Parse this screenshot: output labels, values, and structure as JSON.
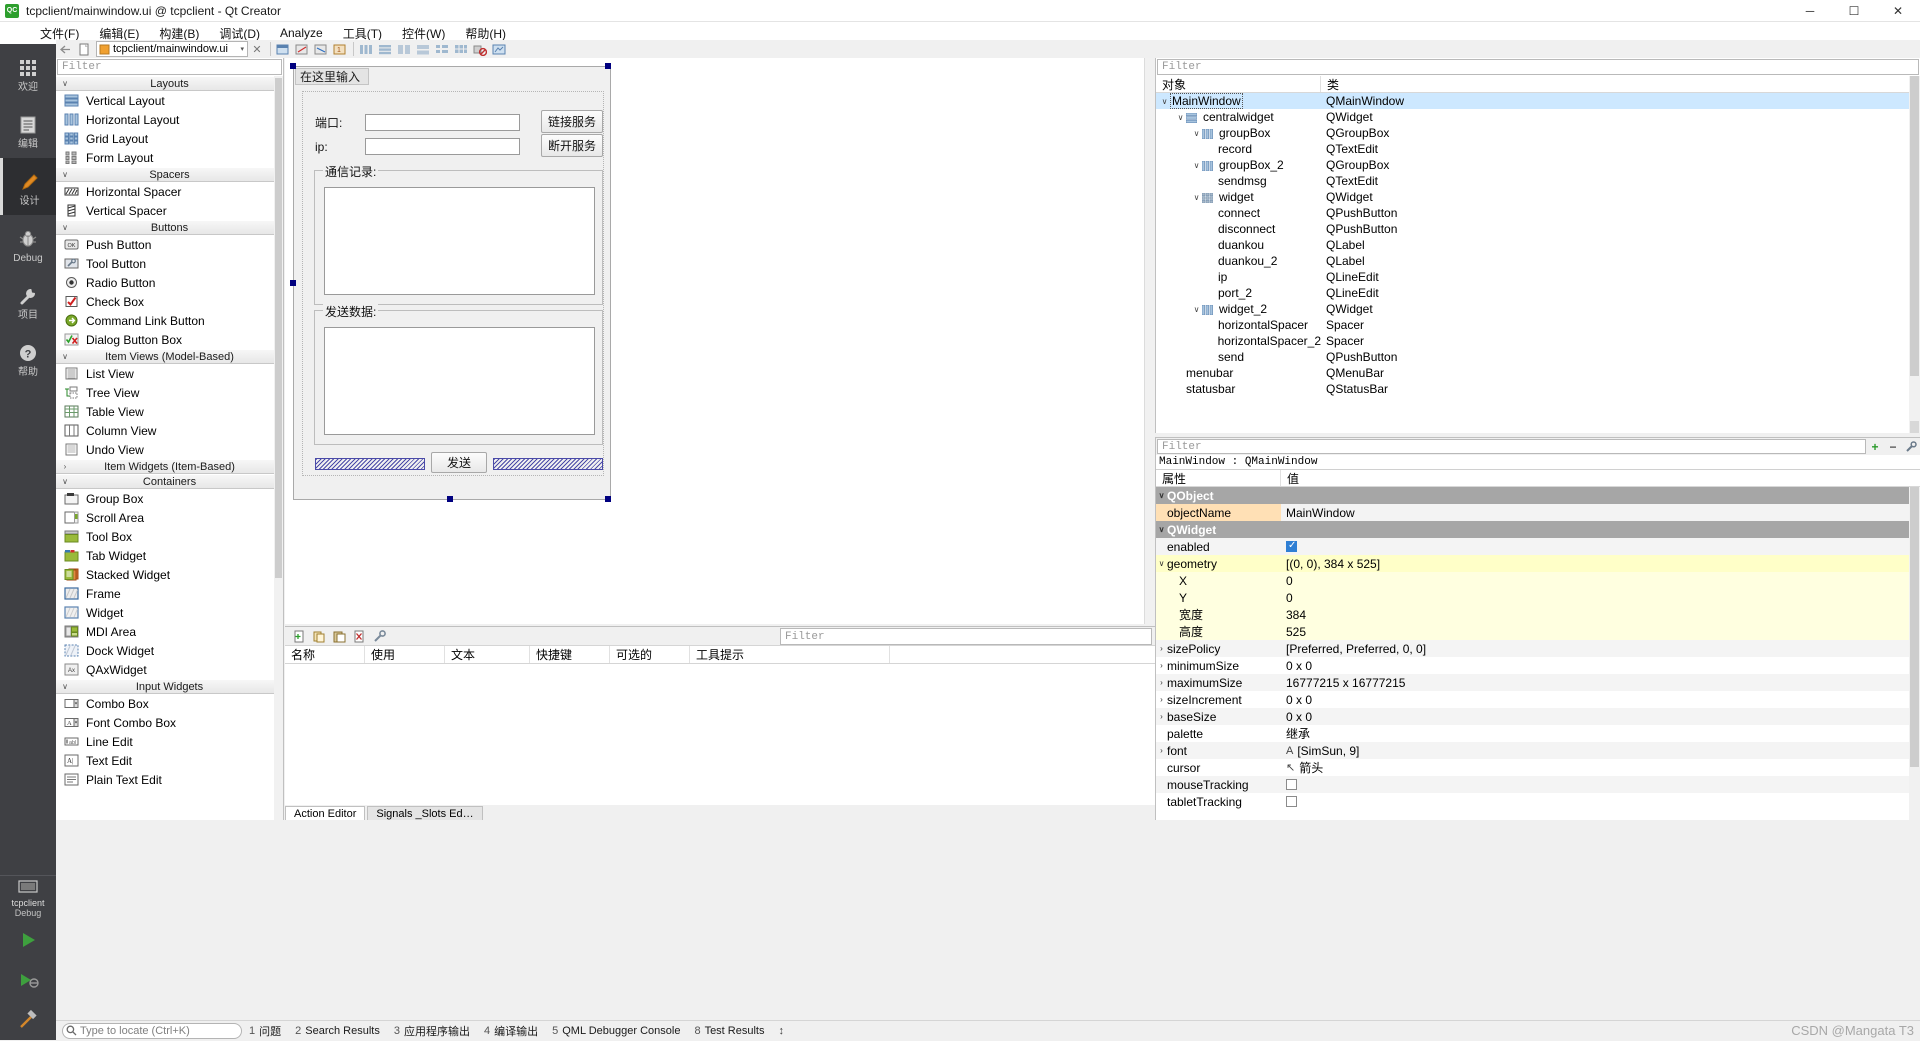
{
  "window": {
    "title": "tcpclient/mainwindow.ui @ tcpclient - Qt Creator",
    "logo_text": "QC",
    "minimize": "─",
    "maximize": "☐",
    "close": "✕"
  },
  "menubar": {
    "items": [
      {
        "label": "文件(F)",
        "name": "menu-file"
      },
      {
        "label": "编辑(E)",
        "name": "menu-edit"
      },
      {
        "label": "构建(B)",
        "name": "menu-build"
      },
      {
        "label": "调试(D)",
        "name": "menu-debug"
      },
      {
        "label": "Analyze",
        "name": "menu-analyze"
      },
      {
        "label": "工具(T)",
        "name": "menu-tools"
      },
      {
        "label": "控件(W)",
        "name": "menu-window"
      },
      {
        "label": "帮助(H)",
        "name": "menu-help"
      }
    ]
  },
  "modebar": {
    "modes": [
      {
        "label": "欢迎",
        "icon": "grid-icon",
        "name": "mode-welcome",
        "active": false
      },
      {
        "label": "编辑",
        "icon": "document-icon",
        "name": "mode-edit",
        "active": false
      },
      {
        "label": "设计",
        "icon": "pencil-icon",
        "name": "mode-design",
        "active": true
      },
      {
        "label": "Debug",
        "icon": "bug-icon",
        "name": "mode-debug",
        "active": false
      },
      {
        "label": "项目",
        "icon": "wrench-icon",
        "name": "mode-projects",
        "active": false
      },
      {
        "label": "帮助",
        "icon": "question-icon",
        "name": "mode-help",
        "active": false
      }
    ],
    "kit": {
      "project": "tcpclient",
      "config": "Debug"
    },
    "run": {
      "run_label": "run-icon",
      "debug_label": "debug-run-icon",
      "build_label": "hammer-icon"
    }
  },
  "doctoolbar": {
    "current_document": "tcpclient/mainwindow.ui",
    "dropdown_arrow": "▾",
    "close_icon": "✕"
  },
  "widgetbox": {
    "filter_placeholder": "Filter",
    "categories": [
      {
        "name": "Layouts",
        "expanded": true,
        "items": [
          {
            "label": "Vertical Layout",
            "icon": "vertical-layout-icon"
          },
          {
            "label": "Horizontal Layout",
            "icon": "horizontal-layout-icon"
          },
          {
            "label": "Grid Layout",
            "icon": "grid-layout-icon"
          },
          {
            "label": "Form Layout",
            "icon": "form-layout-icon"
          }
        ]
      },
      {
        "name": "Spacers",
        "expanded": true,
        "items": [
          {
            "label": "Horizontal Spacer",
            "icon": "horizontal-spacer-icon"
          },
          {
            "label": "Vertical Spacer",
            "icon": "vertical-spacer-icon"
          }
        ]
      },
      {
        "name": "Buttons",
        "expanded": true,
        "items": [
          {
            "label": "Push Button",
            "icon": "push-button-icon"
          },
          {
            "label": "Tool Button",
            "icon": "tool-button-icon"
          },
          {
            "label": "Radio Button",
            "icon": "radio-button-icon"
          },
          {
            "label": "Check Box",
            "icon": "check-box-icon"
          },
          {
            "label": "Command Link Button",
            "icon": "command-link-icon"
          },
          {
            "label": "Dialog Button Box",
            "icon": "dialog-button-box-icon"
          }
        ]
      },
      {
        "name": "Item Views (Model-Based)",
        "expanded": true,
        "items": [
          {
            "label": "List View",
            "icon": "list-view-icon"
          },
          {
            "label": "Tree View",
            "icon": "tree-view-icon"
          },
          {
            "label": "Table View",
            "icon": "table-view-icon"
          },
          {
            "label": "Column View",
            "icon": "column-view-icon"
          },
          {
            "label": "Undo View",
            "icon": "undo-view-icon"
          }
        ]
      },
      {
        "name": "Item Widgets (Item-Based)",
        "expanded": false,
        "items": []
      },
      {
        "name": "Containers",
        "expanded": true,
        "items": [
          {
            "label": "Group Box",
            "icon": "group-box-icon"
          },
          {
            "label": "Scroll Area",
            "icon": "scroll-area-icon"
          },
          {
            "label": "Tool Box",
            "icon": "tool-box-icon"
          },
          {
            "label": "Tab Widget",
            "icon": "tab-widget-icon"
          },
          {
            "label": "Stacked Widget",
            "icon": "stacked-widget-icon"
          },
          {
            "label": "Frame",
            "icon": "frame-icon"
          },
          {
            "label": "Widget",
            "icon": "widget-icon"
          },
          {
            "label": "MDI Area",
            "icon": "mdi-area-icon"
          },
          {
            "label": "Dock Widget",
            "icon": "dock-widget-icon"
          },
          {
            "label": "QAxWidget",
            "icon": "qax-widget-icon"
          }
        ]
      },
      {
        "name": "Input Widgets",
        "expanded": true,
        "items": [
          {
            "label": "Combo Box",
            "icon": "combo-box-icon"
          },
          {
            "label": "Font Combo Box",
            "icon": "font-combo-box-icon"
          },
          {
            "label": "Line Edit",
            "icon": "line-edit-icon"
          },
          {
            "label": "Text Edit",
            "icon": "text-edit-icon"
          },
          {
            "label": "Plain Text Edit",
            "icon": "plain-text-edit-icon"
          }
        ]
      }
    ]
  },
  "form": {
    "menu_placeholder": "在这里输入",
    "port_label": "端口:",
    "ip_label": "ip:",
    "connect_button": "链接服务",
    "disconnect_button": "断开服务",
    "record_group_title": "通信记录:",
    "send_group_title": "发送数据:",
    "send_button": "发送",
    "port_value": "",
    "ip_value": "",
    "record_value": "",
    "sendmsg_value": ""
  },
  "action_editor": {
    "filter_placeholder": "Filter",
    "columns": [
      "名称",
      "使用",
      "文本",
      "快捷键",
      "可选的",
      "工具提示"
    ],
    "rows": [],
    "tabs": [
      {
        "label": "Action Editor",
        "active": true
      },
      {
        "label": "Signals _Slots Ed…",
        "active": false
      }
    ],
    "toolbar_icons": [
      "new-action-icon",
      "copy-icon",
      "paste-icon",
      "delete-icon",
      "configure-icon"
    ]
  },
  "object_inspector": {
    "filter_placeholder": "Filter",
    "columns": [
      "对象",
      "类"
    ],
    "rows": [
      {
        "name": "MainWindow",
        "cls": "QMainWindow",
        "indent": 0,
        "twist": "∨",
        "icon": "",
        "selected": true
      },
      {
        "name": "centralwidget",
        "cls": "QWidget",
        "indent": 1,
        "twist": "∨",
        "icon": "vlayout",
        "selected": false
      },
      {
        "name": "groupBox",
        "cls": "QGroupBox",
        "indent": 2,
        "twist": "∨",
        "icon": "hlayout",
        "selected": false
      },
      {
        "name": "record",
        "cls": "QTextEdit",
        "indent": 3,
        "twist": "",
        "icon": "",
        "selected": false
      },
      {
        "name": "groupBox_2",
        "cls": "QGroupBox",
        "indent": 2,
        "twist": "∨",
        "icon": "hlayout",
        "selected": false
      },
      {
        "name": "sendmsg",
        "cls": "QTextEdit",
        "indent": 3,
        "twist": "",
        "icon": "",
        "selected": false
      },
      {
        "name": "widget",
        "cls": "QWidget",
        "indent": 2,
        "twist": "∨",
        "icon": "glayout",
        "selected": false
      },
      {
        "name": "connect",
        "cls": "QPushButton",
        "indent": 3,
        "twist": "",
        "icon": "",
        "selected": false
      },
      {
        "name": "disconnect",
        "cls": "QPushButton",
        "indent": 3,
        "twist": "",
        "icon": "",
        "selected": false
      },
      {
        "name": "duankou",
        "cls": "QLabel",
        "indent": 3,
        "twist": "",
        "icon": "",
        "selected": false
      },
      {
        "name": "duankou_2",
        "cls": "QLabel",
        "indent": 3,
        "twist": "",
        "icon": "",
        "selected": false
      },
      {
        "name": "ip",
        "cls": "QLineEdit",
        "indent": 3,
        "twist": "",
        "icon": "",
        "selected": false
      },
      {
        "name": "port_2",
        "cls": "QLineEdit",
        "indent": 3,
        "twist": "",
        "icon": "",
        "selected": false
      },
      {
        "name": "widget_2",
        "cls": "QWidget",
        "indent": 2,
        "twist": "∨",
        "icon": "hlayout",
        "selected": false
      },
      {
        "name": "horizontalSpacer",
        "cls": "Spacer",
        "indent": 3,
        "twist": "",
        "icon": "",
        "selected": false
      },
      {
        "name": "horizontalSpacer_2",
        "cls": "Spacer",
        "indent": 3,
        "twist": "",
        "icon": "",
        "selected": false
      },
      {
        "name": "send",
        "cls": "QPushButton",
        "indent": 3,
        "twist": "",
        "icon": "",
        "selected": false
      },
      {
        "name": "menubar",
        "cls": "QMenuBar",
        "indent": 1,
        "twist": "",
        "icon": "",
        "selected": false
      },
      {
        "name": "statusbar",
        "cls": "QStatusBar",
        "indent": 1,
        "twist": "",
        "icon": "",
        "selected": false
      }
    ]
  },
  "property_editor": {
    "filter_placeholder": "Filter",
    "object_header": "MainWindow : QMainWindow",
    "columns": [
      "属性",
      "值"
    ],
    "add_icon": "+",
    "remove_icon": "−",
    "config_icon": "🔧",
    "rows": [
      {
        "key": "QObject",
        "value": "",
        "kind": "group",
        "twist": "∨"
      },
      {
        "key": "objectName",
        "value": "MainWindow",
        "kind": "hl",
        "twist": ""
      },
      {
        "key": "QWidget",
        "value": "",
        "kind": "group",
        "twist": "∨"
      },
      {
        "key": "enabled",
        "value": "",
        "kind": "alt",
        "twist": "",
        "checkbox": true
      },
      {
        "key": "geometry",
        "value": "[(0, 0), 384 x 525]",
        "kind": "geo",
        "twist": "∨"
      },
      {
        "key": "X",
        "value": "0",
        "kind": "sub",
        "twist": ""
      },
      {
        "key": "Y",
        "value": "0",
        "kind": "sub",
        "twist": ""
      },
      {
        "key": "宽度",
        "value": "384",
        "kind": "sub",
        "twist": ""
      },
      {
        "key": "高度",
        "value": "525",
        "kind": "sub",
        "twist": ""
      },
      {
        "key": "sizePolicy",
        "value": "[Preferred, Preferred, 0, 0]",
        "kind": "alt",
        "twist": "›"
      },
      {
        "key": "minimumSize",
        "value": "0 x 0",
        "kind": "",
        "twist": "›"
      },
      {
        "key": "maximumSize",
        "value": "16777215 x 16777215",
        "kind": "alt",
        "twist": "›"
      },
      {
        "key": "sizeIncrement",
        "value": "0 x 0",
        "kind": "",
        "twist": "›"
      },
      {
        "key": "baseSize",
        "value": "0 x 0",
        "kind": "alt",
        "twist": "›"
      },
      {
        "key": "palette",
        "value": "继承",
        "kind": "",
        "twist": ""
      },
      {
        "key": "font",
        "value": "[SimSun, 9]",
        "kind": "alt",
        "twist": "›",
        "prefix": "A"
      },
      {
        "key": "cursor",
        "value": "箭头",
        "kind": "",
        "twist": "",
        "prefix": "↖"
      },
      {
        "key": "mouseTracking",
        "value": "",
        "kind": "alt",
        "twist": "",
        "checkbox": false
      },
      {
        "key": "tabletTracking",
        "value": "",
        "kind": "",
        "twist": "",
        "checkbox": false
      }
    ]
  },
  "statusbar": {
    "locator_placeholder": "Type to locate (Ctrl+K)",
    "search_icon": "search-icon",
    "outputs": [
      {
        "num": "1",
        "label": "问题"
      },
      {
        "num": "2",
        "label": "Search Results"
      },
      {
        "num": "3",
        "label": "应用程序输出"
      },
      {
        "num": "4",
        "label": "编译输出"
      },
      {
        "num": "5",
        "label": "QML Debugger Console"
      },
      {
        "num": "8",
        "label": "Test Results"
      }
    ],
    "more_arrow": "↕",
    "watermark": "CSDN @Mangata T3"
  },
  "colors": {
    "accent": "#2f7fd4",
    "modebar_bg": "#3f4044",
    "selection": "#cde8ff",
    "group_header": "#a6a6a6",
    "highlight_key": "#ffe0b5",
    "geometry_row": "#ffffc8"
  }
}
